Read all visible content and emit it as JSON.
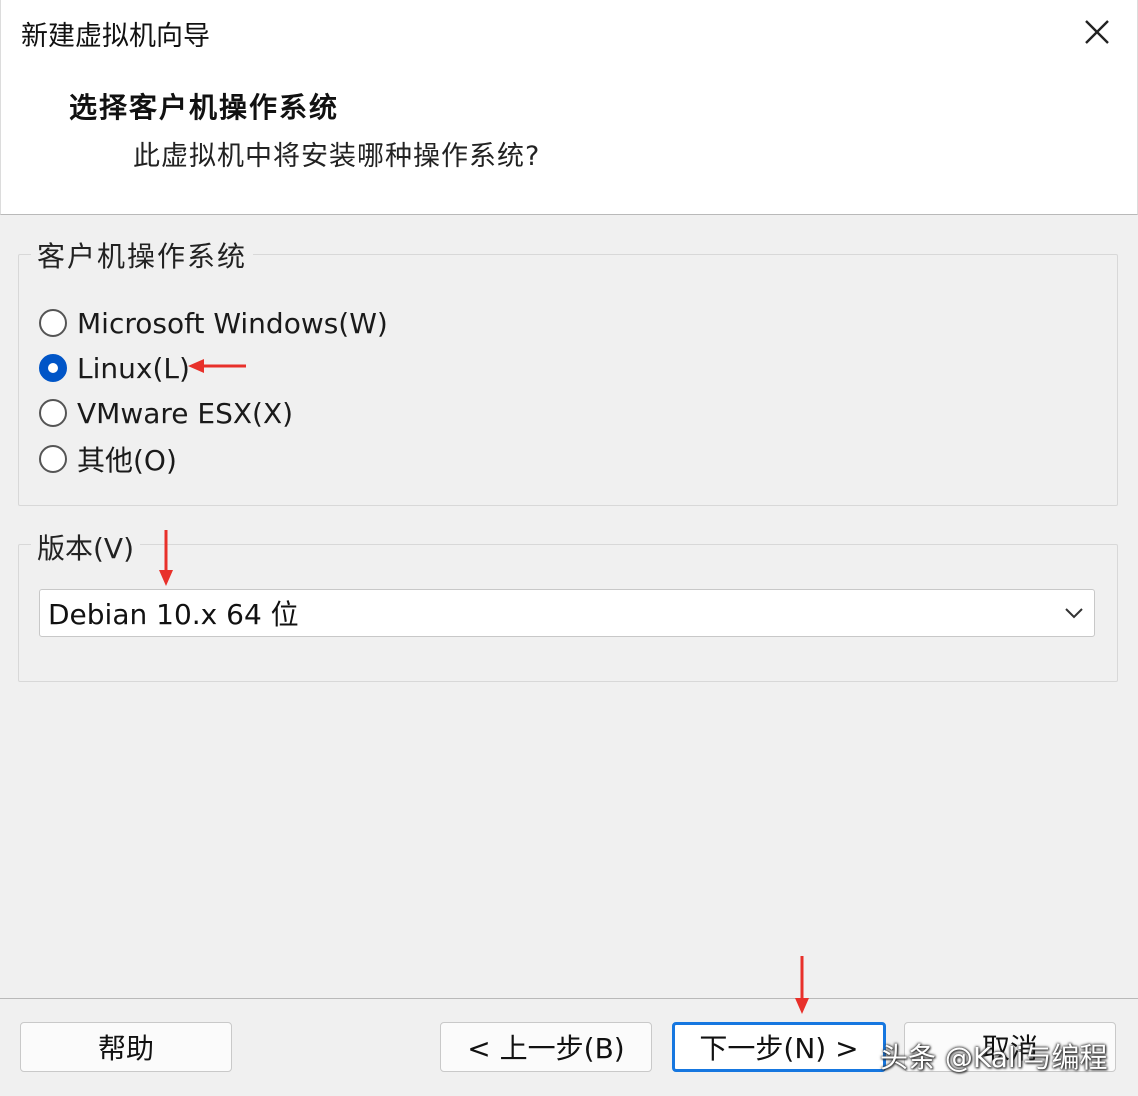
{
  "window": {
    "title": "新建虚拟机向导",
    "close_glyph": "✕"
  },
  "header": {
    "heading": "选择客户机操作系统",
    "subheading": "此虚拟机中将安装哪种操作系统?"
  },
  "os_group": {
    "legend": "客户机操作系统",
    "options": [
      {
        "label": "Microsoft Windows(W)",
        "checked": false
      },
      {
        "label": "Linux(L)",
        "checked": true
      },
      {
        "label": "VMware ESX(X)",
        "checked": false
      },
      {
        "label": "其他(O)",
        "checked": false
      }
    ]
  },
  "version_group": {
    "legend": "版本(V)",
    "selected": "Debian 10.x 64 位",
    "chevron_icon": "chevron-down-icon"
  },
  "footer": {
    "help": "帮助",
    "back": "< 上一步(B)",
    "next": "下一步(N) >",
    "cancel": "取消"
  },
  "watermark": {
    "text": "头条 @Kali与编程"
  },
  "colors": {
    "radio_checked": "#0055c7",
    "primary_border": "#1677e0",
    "annotation_arrow": "#e8302a"
  }
}
